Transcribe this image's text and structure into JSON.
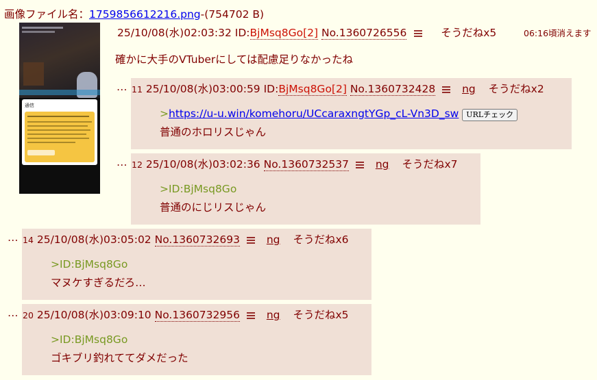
{
  "image_info": {
    "label": "画像ファイル名：",
    "filename": "1759856612216.png",
    "size": "-(754702 B)"
  },
  "op": {
    "datetime": "25/10/08(水)02:03:32",
    "id_label": "ID:",
    "id_value": "BjMsq8Go[2]",
    "no": "No.1360726556",
    "soudane": "そうだねx5",
    "expire": "06:16頃消えます",
    "comment": "確かに大手のVTuberにしては配慮足りなかったね"
  },
  "thumbnail": {
    "caption": "通信"
  },
  "replies": [
    {
      "prefix": "…",
      "num": "11",
      "datetime": "25/10/08(水)03:00:59",
      "id_label": "ID:",
      "id_value": "BjMsq8Go[2]",
      "no": "No.1360732428",
      "ng": "ng",
      "soudane": "そうだねx2",
      "quote_mark": ">",
      "link": "https://u-u.win/komehoru/UCcaraxngtYGp_cL-Vn3D_sw",
      "url_check": "URLチェック",
      "body": "普通のホロリスじゃん"
    },
    {
      "prefix": "…",
      "num": "12",
      "datetime": "25/10/08(水)03:02:36",
      "no": "No.1360732537",
      "ng": "ng",
      "soudane": "そうだねx7",
      "quote": ">ID:BjMsq8Go",
      "body": "普通のにじリスじゃん"
    },
    {
      "prefix": "…",
      "num": "14",
      "datetime": "25/10/08(水)03:05:02",
      "no": "No.1360732693",
      "ng": "ng",
      "soudane": "そうだねx6",
      "quote": ">ID:BjMsq8Go",
      "body": "マヌケすぎるだろ…"
    },
    {
      "prefix": "…",
      "num": "20",
      "datetime": "25/10/08(水)03:09:10",
      "no": "No.1360732956",
      "ng": "ng",
      "soudane": "そうだねx5",
      "quote": ">ID:BjMsq8Go",
      "body": "ゴキブリ釣れててダメだった"
    }
  ]
}
